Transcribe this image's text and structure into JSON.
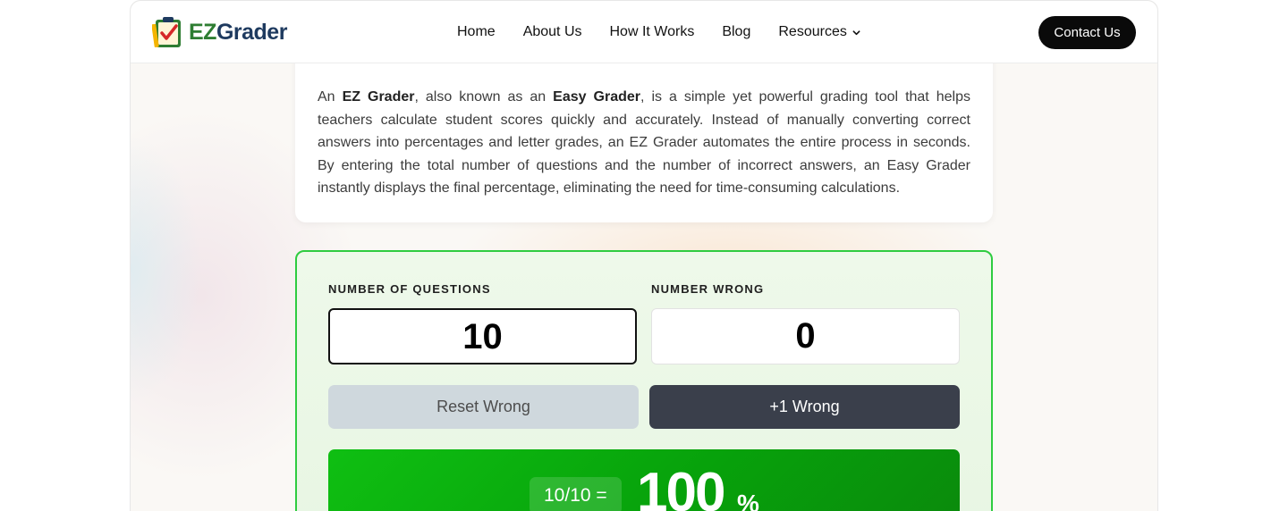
{
  "header": {
    "logo": {
      "ez": "EZ",
      "grader": "Grader"
    },
    "nav": [
      {
        "label": "Home"
      },
      {
        "label": "About Us"
      },
      {
        "label": "How It Works"
      },
      {
        "label": "Blog"
      },
      {
        "label": "Resources",
        "dropdown": true
      }
    ],
    "contact_label": "Contact Us"
  },
  "intro": {
    "p1": "An ",
    "b1": "EZ Grader",
    "p2": ", also known as an ",
    "b2": "Easy Grader",
    "p3": ", is a simple yet powerful grading tool that helps teachers calculate student scores quickly and accurately. Instead of manually converting correct answers into percentages and letter grades, an EZ Grader automates the entire process in seconds. By entering the total number of questions and the number of incorrect answers, an Easy Grader instantly displays the final percentage, eliminating the need for time-consuming calculations."
  },
  "calculator": {
    "questions_label": "NUMBER OF QUESTIONS",
    "questions_value": "10",
    "wrong_label": "NUMBER WRONG",
    "wrong_value": "0",
    "reset_label": "Reset Wrong",
    "plus_label": "+1 Wrong",
    "result": {
      "fraction": "10/10 =",
      "percent": "100",
      "percent_sign": "%"
    }
  },
  "colors": {
    "accent_green": "#2ecc40",
    "result_green": "#07a20b",
    "dark_button": "#3a3f4b",
    "logo_green": "#2e7d32",
    "logo_navy": "#1e3a5f"
  }
}
